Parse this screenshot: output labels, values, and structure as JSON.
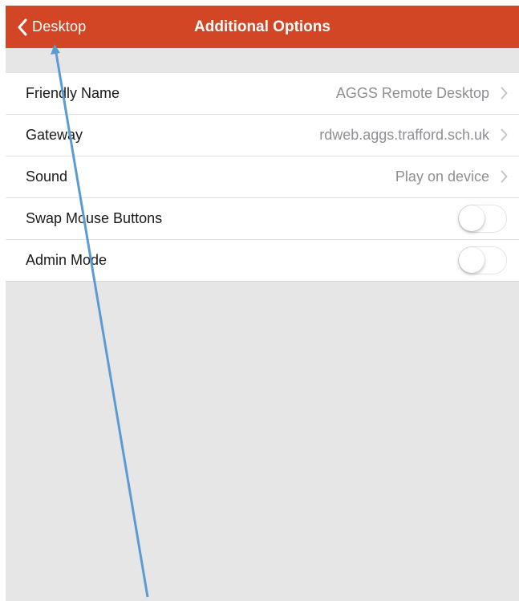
{
  "navbar": {
    "back_label": "Desktop",
    "title": "Additional Options",
    "background_color": "#d24625"
  },
  "settings": {
    "rows": [
      {
        "label": "Friendly Name",
        "value": "AGGS Remote Desktop",
        "type": "disclosure"
      },
      {
        "label": "Gateway",
        "value": "rdweb.aggs.trafford.sch.uk",
        "type": "disclosure"
      },
      {
        "label": "Sound",
        "value": "Play on device",
        "type": "disclosure"
      },
      {
        "label": "Swap Mouse Buttons",
        "type": "toggle",
        "on": false
      },
      {
        "label": "Admin Mode",
        "type": "toggle",
        "on": false
      }
    ]
  },
  "annotation": {
    "arrow_color": "#5b9bd5",
    "points_to": "back-button"
  }
}
